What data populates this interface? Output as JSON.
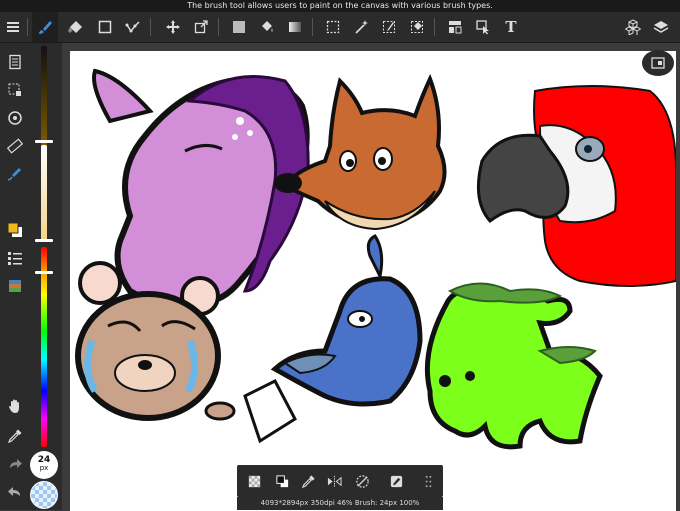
{
  "status": {
    "message": "The brush tool allows users to paint on the canvas with various brush types."
  },
  "toolbar": {
    "items": [
      "menu-icon",
      "brush-icon",
      "eraser-icon",
      "rectangle-icon",
      "path-icon",
      "move-icon",
      "transform-icon",
      "fill-color-icon",
      "bucket-icon",
      "gradient-icon",
      "select-rect-icon",
      "magic-wand-icon",
      "select-pen-icon",
      "select-eraser-icon",
      "layout-icon",
      "pointer-icon",
      "text-icon",
      "materials-icon",
      "layers-icon"
    ],
    "text_label": "T"
  },
  "brush": {
    "size": "24",
    "unit": "px"
  },
  "info": {
    "text": "4093*2894px 350dpi 46% Brush: 24px 100%"
  },
  "colors": {
    "primary": "#f3b81a",
    "secondary": "#ffffff",
    "accent": "#3a8fe0"
  }
}
